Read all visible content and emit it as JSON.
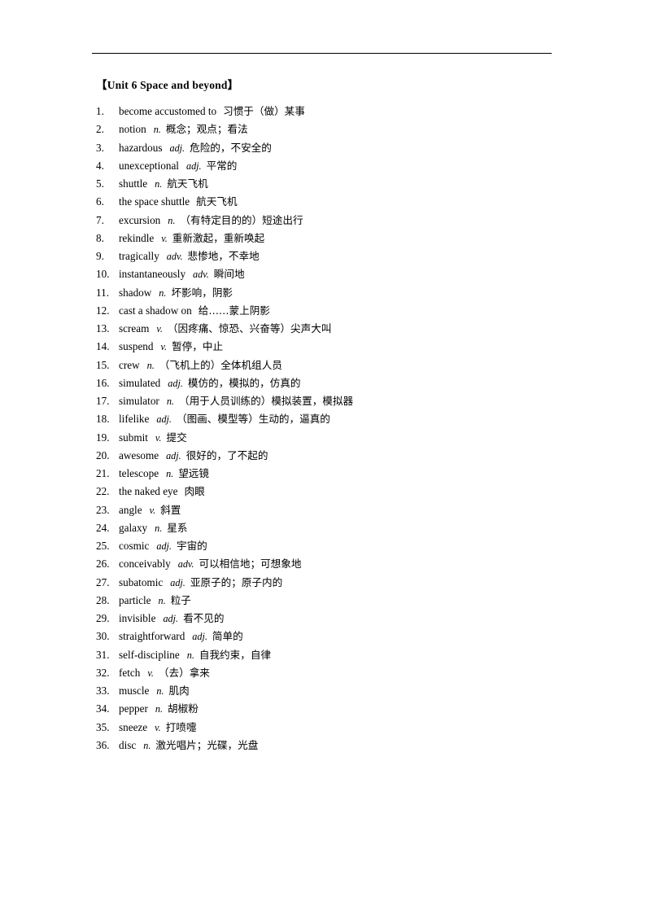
{
  "document": {
    "title": "【Unit 6 Space and beyond】",
    "has_header_rule": true
  },
  "vocabulary": [
    {
      "num": "1.",
      "word": "become accustomed to",
      "pos": "",
      "definition": "习惯于（做）某事"
    },
    {
      "num": "2.",
      "word": "notion",
      "pos": "n.",
      "definition": "概念；观点；看法"
    },
    {
      "num": "3.",
      "word": "hazardous",
      "pos": "adj.",
      "definition": "危险的，不安全的"
    },
    {
      "num": "4.",
      "word": "unexceptional",
      "pos": "adj.",
      "definition": "平常的"
    },
    {
      "num": "5.",
      "word": "shuttle",
      "pos": "n.",
      "definition": "航天飞机"
    },
    {
      "num": "6.",
      "word": "the space shuttle",
      "pos": "",
      "definition": "航天飞机"
    },
    {
      "num": "7.",
      "word": "excursion",
      "pos": "n.",
      "definition": "（有特定目的的）短途出行"
    },
    {
      "num": "8.",
      "word": "rekindle",
      "pos": "v.",
      "definition": "重新激起，重新唤起"
    },
    {
      "num": "9.",
      "word": "tragically",
      "pos": "adv.",
      "definition": "悲惨地，不幸地"
    },
    {
      "num": "10.",
      "word": "instantaneously",
      "pos": "adv.",
      "definition": "瞬间地"
    },
    {
      "num": "11.",
      "word": "shadow",
      "pos": "n.",
      "definition": "坏影响，阴影"
    },
    {
      "num": "12.",
      "word": "cast a shadow on",
      "pos": "",
      "definition": "给……蒙上阴影"
    },
    {
      "num": "13.",
      "word": "scream",
      "pos": "v.",
      "definition": "（因疼痛、惊恐、兴奋等）尖声大叫"
    },
    {
      "num": "14.",
      "word": "suspend",
      "pos": "v.",
      "definition": "暂停，中止"
    },
    {
      "num": "15.",
      "word": "crew",
      "pos": "n.",
      "definition": "（飞机上的）全体机组人员"
    },
    {
      "num": "16.",
      "word": "simulated",
      "pos": "adj.",
      "definition": "模仿的，模拟的，仿真的"
    },
    {
      "num": "17.",
      "word": "simulator",
      "pos": "n.",
      "definition": "（用于人员训练的）模拟装置，模拟器"
    },
    {
      "num": "18.",
      "word": "lifelike",
      "pos": "adj.",
      "definition": "（图画、模型等）生动的，逼真的"
    },
    {
      "num": "19.",
      "word": "submit",
      "pos": "v.",
      "definition": "提交"
    },
    {
      "num": "20.",
      "word": "awesome",
      "pos": "adj.",
      "definition": "很好的，了不起的"
    },
    {
      "num": "21.",
      "word": "telescope",
      "pos": "n.",
      "definition": "望远镜"
    },
    {
      "num": "22.",
      "word": "the naked eye",
      "pos": "",
      "definition": "肉眼"
    },
    {
      "num": "23.",
      "word": "angle",
      "pos": "v.",
      "definition": "斜置"
    },
    {
      "num": "24.",
      "word": "galaxy",
      "pos": "n.",
      "definition": "星系"
    },
    {
      "num": "25.",
      "word": "cosmic",
      "pos": "adj.",
      "definition": "宇宙的"
    },
    {
      "num": "26.",
      "word": "conceivably",
      "pos": "adv.",
      "definition": "可以相信地；可想象地"
    },
    {
      "num": "27.",
      "word": "subatomic",
      "pos": "adj.",
      "definition": "亚原子的；原子内的"
    },
    {
      "num": "28.",
      "word": "particle",
      "pos": "n.",
      "definition": "粒子"
    },
    {
      "num": "29.",
      "word": "invisible",
      "pos": "adj.",
      "definition": "看不见的"
    },
    {
      "num": "30.",
      "word": "straightforward",
      "pos": "adj.",
      "definition": "简单的"
    },
    {
      "num": "31.",
      "word": "self-discipline",
      "pos": "n.",
      "definition": "自我约束，自律"
    },
    {
      "num": "32.",
      "word": "fetch",
      "pos": "v.",
      "definition": "（去）拿来"
    },
    {
      "num": "33.",
      "word": "muscle",
      "pos": "n.",
      "definition": "肌肉"
    },
    {
      "num": "34.",
      "word": "pepper",
      "pos": "n.",
      "definition": "胡椒粉"
    },
    {
      "num": "35.",
      "word": "sneeze",
      "pos": "v.",
      "definition": "打喷嚏"
    },
    {
      "num": "36.",
      "word": "disc",
      "pos": "n.",
      "definition": "激光唱片；光碟，光盘"
    }
  ]
}
